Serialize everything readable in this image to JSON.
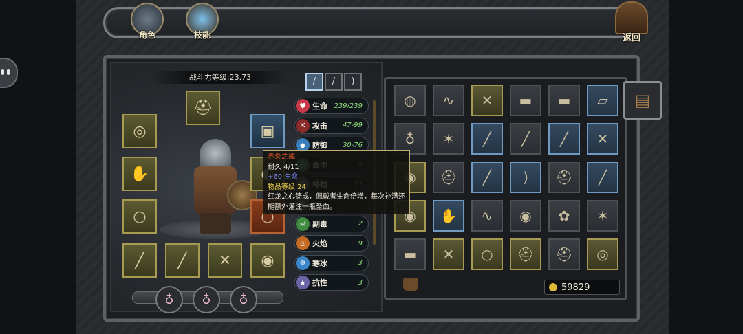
{
  "topbar": {
    "role_label": "角色",
    "skill_label": "技能",
    "back_label": "返回"
  },
  "character": {
    "power_label": "战斗力等级:23.73",
    "weapon_tabs": [
      "sword-icon",
      "spear-icon",
      "bow-icon"
    ]
  },
  "stats": [
    {
      "name": "生命",
      "value": "239/239",
      "icon": "heart-icon",
      "color": "#c9394a"
    },
    {
      "name": "攻击",
      "value": "47-99",
      "icon": "crossed-swords-icon",
      "color": "#8a2a2a"
    },
    {
      "name": "防御",
      "value": "30-76",
      "icon": "shield-icon",
      "color": "#3a7dbb"
    },
    {
      "name": "命中",
      "value": "5",
      "icon": "target-icon",
      "color": "#4d9a58"
    },
    {
      "name": "格挡",
      "value": "21",
      "icon": "block-icon",
      "color": "#6a6f75"
    },
    {
      "name": "",
      "value": "",
      "icon": "crit-icon",
      "color": "#6a6f75"
    },
    {
      "name": "副毒",
      "value": "2",
      "icon": "poison-icon",
      "color": "#3f8a3f"
    },
    {
      "name": "火焰",
      "value": "9",
      "icon": "fire-icon",
      "color": "#c46a22"
    },
    {
      "name": "寒冰",
      "value": "3",
      "icon": "ice-icon",
      "color": "#3a86c9"
    },
    {
      "name": "抗性",
      "value": "3",
      "icon": "star-icon",
      "color": "#6b63a6"
    }
  ],
  "tooltip": {
    "name": "赤炎之戒",
    "durability": "耐久  4/11",
    "bonus": "+60  生命",
    "level": "物品等级  24",
    "desc": "红龙之心铸成，佩戴者生命倍增，每次补满还能额外灌注一瓶圣血。"
  },
  "inventory": {
    "gold": "59829"
  },
  "colors": {
    "gold_slot": "#a79a52",
    "blue_slot": "#6f9ac2",
    "stat_value": "#8fe07a"
  }
}
